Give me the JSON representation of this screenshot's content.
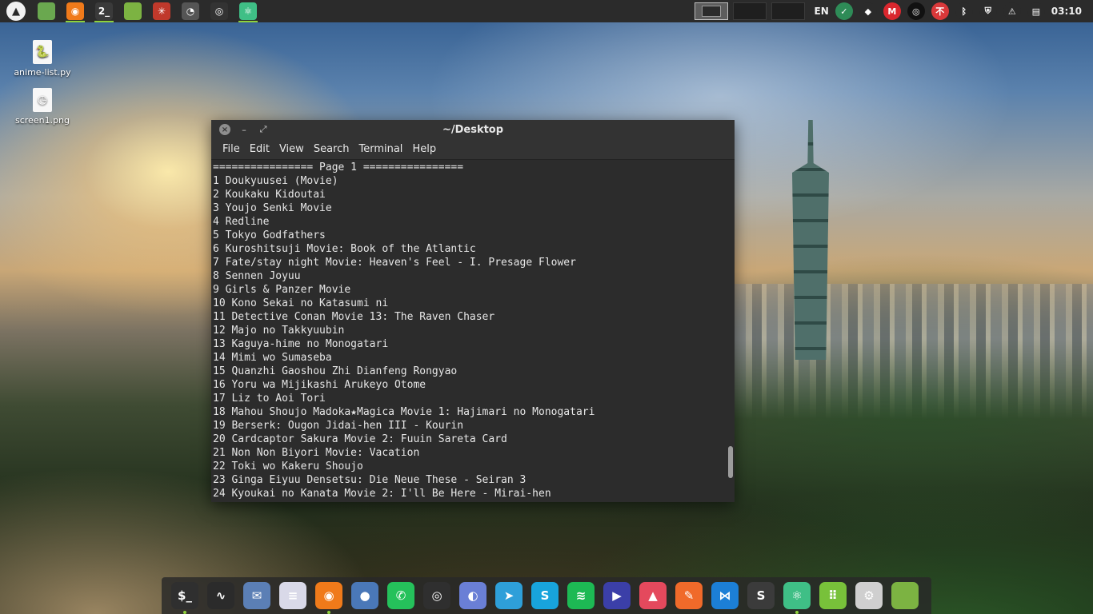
{
  "panel": {
    "launcher_icon": "distro-logo-icon",
    "task_icons": [
      {
        "name": "show-desktop",
        "glyph": "",
        "color": "#6aa84f",
        "active": false
      },
      {
        "name": "firefox",
        "glyph": "◉",
        "color": "#f07a1a",
        "active": true
      },
      {
        "name": "terminal",
        "glyph": "2_",
        "color": "#3a3a3a",
        "active": true
      },
      {
        "name": "files",
        "glyph": "",
        "color": "#7cb342",
        "active": false
      },
      {
        "name": "web-spider",
        "glyph": "✳",
        "color": "#c0392b",
        "active": false
      },
      {
        "name": "ghost",
        "glyph": "◔",
        "color": "#555555",
        "active": false
      },
      {
        "name": "obs",
        "glyph": "◎",
        "color": "#333333",
        "active": false
      },
      {
        "name": "atom",
        "glyph": "⚛",
        "color": "#3fbf86",
        "active": true
      }
    ],
    "language": "EN",
    "clock": "03:10",
    "tray_icons": [
      {
        "name": "network-check",
        "glyph": "✓",
        "color": "#2e8b57"
      },
      {
        "name": "dropbox",
        "glyph": "◆",
        "color": "#2b2b2b"
      },
      {
        "name": "mega",
        "glyph": "M",
        "color": "#d9272e"
      },
      {
        "name": "obs-tray",
        "glyph": "◎",
        "color": "#111111"
      },
      {
        "name": "app-red",
        "glyph": "不",
        "color": "#d9383a"
      },
      {
        "name": "bluetooth",
        "glyph": "ᛒ",
        "color": "#2b2b2b"
      },
      {
        "name": "shield",
        "glyph": "⛨",
        "color": "#2b2b2b"
      },
      {
        "name": "notification",
        "glyph": "⚠",
        "color": "#2b2b2b"
      },
      {
        "name": "clipboard",
        "glyph": "▤",
        "color": "#2b2b2b"
      }
    ]
  },
  "desktop": {
    "icons": [
      {
        "label": "anime-list.py",
        "glyph": "🐍"
      },
      {
        "label": "screen1.png",
        "glyph": "◷"
      }
    ]
  },
  "terminal": {
    "title": "~/Desktop",
    "menu": [
      "File",
      "Edit",
      "View",
      "Search",
      "Terminal",
      "Help"
    ],
    "lines": [
      "================ Page 1 ================",
      "1 Doukyuusei (Movie)",
      "2 Koukaku Kidoutai",
      "3 Youjo Senki Movie",
      "4 Redline",
      "5 Tokyo Godfathers",
      "6 Kuroshitsuji Movie: Book of the Atlantic",
      "7 Fate/stay night Movie: Heaven's Feel - I. Presage Flower",
      "8 Sennen Joyuu",
      "9 Girls & Panzer Movie",
      "10 Kono Sekai no Katasumi ni",
      "11 Detective Conan Movie 13: The Raven Chaser",
      "12 Majo no Takkyuubin",
      "13 Kaguya-hime no Monogatari",
      "14 Mimi wo Sumaseba",
      "15 Quanzhi Gaoshou Zhi Dianfeng Rongyao",
      "16 Yoru wa Mijikashi Arukeyo Otome",
      "17 Liz to Aoi Tori",
      "18 Mahou Shoujo Madoka★Magica Movie 1: Hajimari no Monogatari",
      "19 Berserk: Ougon Jidai-hen III - Kourin",
      "20 Cardcaptor Sakura Movie 2: Fuuin Sareta Card",
      "21 Non Non Biyori Movie: Vacation",
      "22 Toki wo Kakeru Shoujo",
      "23 Ginga Eiyuu Densetsu: Die Neue These - Seiran 3",
      "24 Kyoukai no Kanata Movie 2: I'll Be Here - Mirai-hen"
    ]
  },
  "dock": {
    "items": [
      {
        "name": "terminal",
        "glyph": "$_",
        "color": "#2f2f2f",
        "running": true
      },
      {
        "name": "system-monitor",
        "glyph": "∿",
        "color": "#2b2b2b",
        "running": false
      },
      {
        "name": "mail",
        "glyph": "✉",
        "color": "#5b7fb5",
        "running": false
      },
      {
        "name": "text-editor",
        "glyph": "≡",
        "color": "#d9d9e8",
        "running": false
      },
      {
        "name": "firefox",
        "glyph": "◉",
        "color": "#f07a1a",
        "running": true
      },
      {
        "name": "chromium",
        "glyph": "●",
        "color": "#4a78b8",
        "running": false
      },
      {
        "name": "whatsapp",
        "glyph": "✆",
        "color": "#25c15b",
        "running": false
      },
      {
        "name": "obs",
        "glyph": "◎",
        "color": "#2f2f2f",
        "running": false
      },
      {
        "name": "discord",
        "glyph": "◐",
        "color": "#6a7fd6",
        "running": false
      },
      {
        "name": "telegram",
        "glyph": "➤",
        "color": "#2e9fd9",
        "running": false
      },
      {
        "name": "skype",
        "glyph": "S",
        "color": "#18a4dc",
        "running": false
      },
      {
        "name": "spotify",
        "glyph": "≋",
        "color": "#1db954",
        "running": false
      },
      {
        "name": "media-player",
        "glyph": "▶",
        "color": "#3b3fa8",
        "running": false
      },
      {
        "name": "image-viewer",
        "glyph": "▲",
        "color": "#e4495d",
        "running": false
      },
      {
        "name": "drawing",
        "glyph": "✎",
        "color": "#f06a2a",
        "running": false
      },
      {
        "name": "vscode",
        "glyph": "⋈",
        "color": "#1c7fd6",
        "running": false
      },
      {
        "name": "sublime",
        "glyph": "S",
        "color": "#3b3b3b",
        "running": false
      },
      {
        "name": "atom",
        "glyph": "⚛",
        "color": "#3fbf86",
        "running": true
      },
      {
        "name": "apps-grid",
        "glyph": "⠿",
        "color": "#78c13a",
        "running": false
      },
      {
        "name": "settings",
        "glyph": "⚙",
        "color": "#cfcfcf",
        "running": false
      },
      {
        "name": "files",
        "glyph": "",
        "color": "#7cb342",
        "running": false
      }
    ]
  }
}
